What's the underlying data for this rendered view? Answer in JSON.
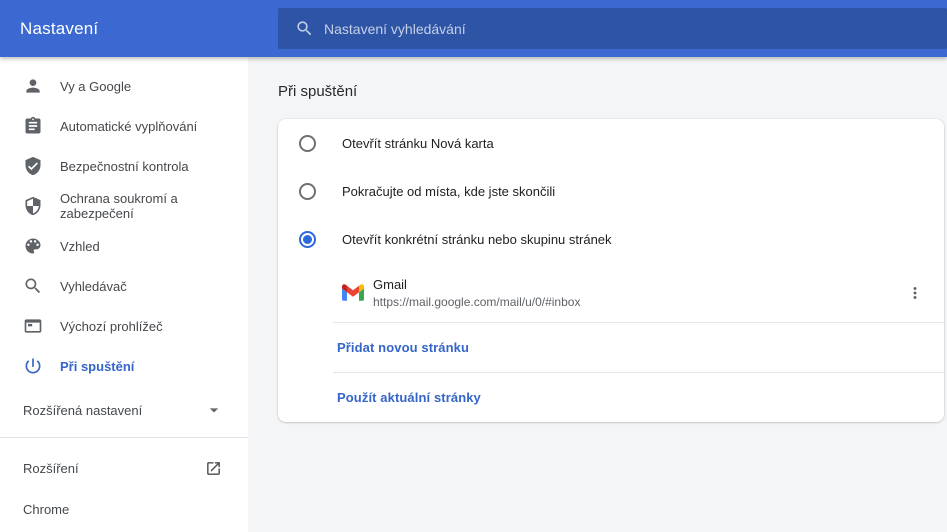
{
  "header": {
    "title": "Nastavení",
    "search_placeholder": "Nastavení vyhledávání"
  },
  "sidebar": {
    "items": [
      {
        "label": "Vy a Google",
        "icon": "person-icon",
        "selected": false
      },
      {
        "label": "Automatické vyplňování",
        "icon": "autofill-clipboard-icon",
        "selected": false
      },
      {
        "label": "Bezpečnostní kontrola",
        "icon": "shield-check-icon",
        "selected": false
      },
      {
        "label": "Ochrana soukromí a zabezpečení",
        "icon": "security-shield-icon",
        "selected": false
      },
      {
        "label": "Vzhled",
        "icon": "palette-icon",
        "selected": false
      },
      {
        "label": "Vyhledávač",
        "icon": "search-icon",
        "selected": false
      },
      {
        "label": "Výchozí prohlížeč",
        "icon": "browser-window-icon",
        "selected": false
      },
      {
        "label": "Při spuštění",
        "icon": "power-icon",
        "selected": true
      }
    ],
    "advanced_label": "Rozšířená nastavení",
    "extensions_label": "Rozšíření",
    "chrome_label": "Chrome"
  },
  "main": {
    "section_title": "Při spuštění",
    "options": [
      {
        "label": "Otevřít stránku Nová karta",
        "selected": false
      },
      {
        "label": "Pokračujte od místa, kde jste skončili",
        "selected": false
      },
      {
        "label": "Otevřít konkrétní stránku nebo skupinu stránek",
        "selected": true
      }
    ],
    "page_entry": {
      "title": "Gmail",
      "url": "https://mail.google.com/mail/u/0/#inbox"
    },
    "add_page_label": "Přidat novou stránku",
    "use_current_label": "Použít aktuální stránky"
  },
  "colors": {
    "header_bg": "#3b69d1",
    "search_bg": "#2e55a5",
    "accent": "#3565c8",
    "radio_accent": "#2c69dd",
    "text_primary": "#202124",
    "text_secondary": "#5f6368",
    "sidebar_bg": "#ffffff",
    "content_bg": "#f4f5f6"
  }
}
